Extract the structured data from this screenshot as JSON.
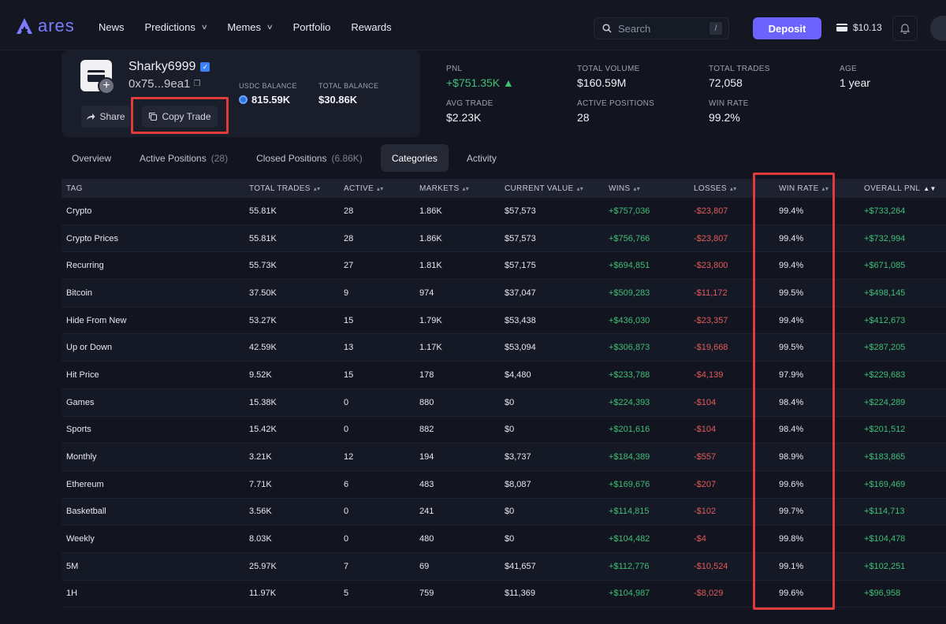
{
  "nav": {
    "logo": "ares",
    "items": [
      {
        "label": "News",
        "dropdown": false
      },
      {
        "label": "Predictions",
        "dropdown": true
      },
      {
        "label": "Memes",
        "dropdown": true
      },
      {
        "label": "Portfolio",
        "dropdown": false
      },
      {
        "label": "Rewards",
        "dropdown": false
      }
    ],
    "search_placeholder": "Search",
    "search_shortcut": "/",
    "deposit_label": "Deposit",
    "wallet_balance": "$10.13"
  },
  "profile": {
    "name": "Sharky6999",
    "address": "0x75...9ea1",
    "usdc_balance_label": "USDC BALANCE",
    "usdc_balance": "815.59K",
    "total_balance_label": "TOTAL BALANCE",
    "total_balance": "$30.86K",
    "share_label": "Share",
    "copy_trade_label": "Copy Trade"
  },
  "stats": [
    {
      "label": "PNL",
      "value": "+$751.35K ▲",
      "positive": true
    },
    {
      "label": "TOTAL VOLUME",
      "value": "$160.59M"
    },
    {
      "label": "TOTAL TRADES",
      "value": "72,058"
    },
    {
      "label": "AGE",
      "value": "1 year"
    },
    {
      "label": "AVG TRADE",
      "value": "$2.23K"
    },
    {
      "label": "ACTIVE POSITIONS",
      "value": "28"
    },
    {
      "label": "WIN RATE",
      "value": "99.2%"
    }
  ],
  "tabs": [
    {
      "label": "Overview",
      "count": ""
    },
    {
      "label": "Active Positions",
      "count": "(28)"
    },
    {
      "label": "Closed Positions",
      "count": "(6.86K)"
    },
    {
      "label": "Categories",
      "count": "",
      "active": true
    },
    {
      "label": "Activity",
      "count": ""
    }
  ],
  "table": {
    "columns": [
      "TAG",
      "TOTAL TRADES",
      "ACTIVE",
      "MARKETS",
      "CURRENT VALUE",
      "WINS",
      "LOSSES",
      "WIN RATE",
      "OVERALL PNL"
    ],
    "rows": [
      [
        "Crypto",
        "55.81K",
        "28",
        "1.86K",
        "$57,573",
        "+$757,036",
        "-$23,807",
        "99.4%",
        "+$733,264"
      ],
      [
        "Crypto Prices",
        "55.81K",
        "28",
        "1.86K",
        "$57,573",
        "+$756,766",
        "-$23,807",
        "99.4%",
        "+$732,994"
      ],
      [
        "Recurring",
        "55.73K",
        "27",
        "1.81K",
        "$57,175",
        "+$694,851",
        "-$23,800",
        "99.4%",
        "+$671,085"
      ],
      [
        "Bitcoin",
        "37.50K",
        "9",
        "974",
        "$37,047",
        "+$509,283",
        "-$11,172",
        "99.5%",
        "+$498,145"
      ],
      [
        "Hide From New",
        "53.27K",
        "15",
        "1.79K",
        "$53,438",
        "+$436,030",
        "-$23,357",
        "99.4%",
        "+$412,673"
      ],
      [
        "Up or Down",
        "42.59K",
        "13",
        "1.17K",
        "$53,094",
        "+$306,873",
        "-$19,668",
        "99.5%",
        "+$287,205"
      ],
      [
        "Hit Price",
        "9.52K",
        "15",
        "178",
        "$4,480",
        "+$233,788",
        "-$4,139",
        "97.9%",
        "+$229,683"
      ],
      [
        "Games",
        "15.38K",
        "0",
        "880",
        "$0",
        "+$224,393",
        "-$104",
        "98.4%",
        "+$224,289"
      ],
      [
        "Sports",
        "15.42K",
        "0",
        "882",
        "$0",
        "+$201,616",
        "-$104",
        "98.4%",
        "+$201,512"
      ],
      [
        "Monthly",
        "3.21K",
        "12",
        "194",
        "$3,737",
        "+$184,389",
        "-$557",
        "98.9%",
        "+$183,865"
      ],
      [
        "Ethereum",
        "7.71K",
        "6",
        "483",
        "$8,087",
        "+$169,676",
        "-$207",
        "99.6%",
        "+$169,469"
      ],
      [
        "Basketball",
        "3.56K",
        "0",
        "241",
        "$0",
        "+$114,815",
        "-$102",
        "99.7%",
        "+$114,713"
      ],
      [
        "Weekly",
        "8.03K",
        "0",
        "480",
        "$0",
        "+$104,482",
        "-$4",
        "99.8%",
        "+$104,478"
      ],
      [
        "5M",
        "25.97K",
        "7",
        "69",
        "$41,657",
        "+$112,776",
        "-$10,524",
        "99.1%",
        "+$102,251"
      ],
      [
        "1H",
        "11.97K",
        "5",
        "759",
        "$11,369",
        "+$104,987",
        "-$8,029",
        "99.6%",
        "+$96,958"
      ]
    ]
  },
  "colors": {
    "accent": "#6c63ff",
    "positive": "#3fbf76",
    "negative": "#e25b5b",
    "highlight": "#e03b3b"
  }
}
